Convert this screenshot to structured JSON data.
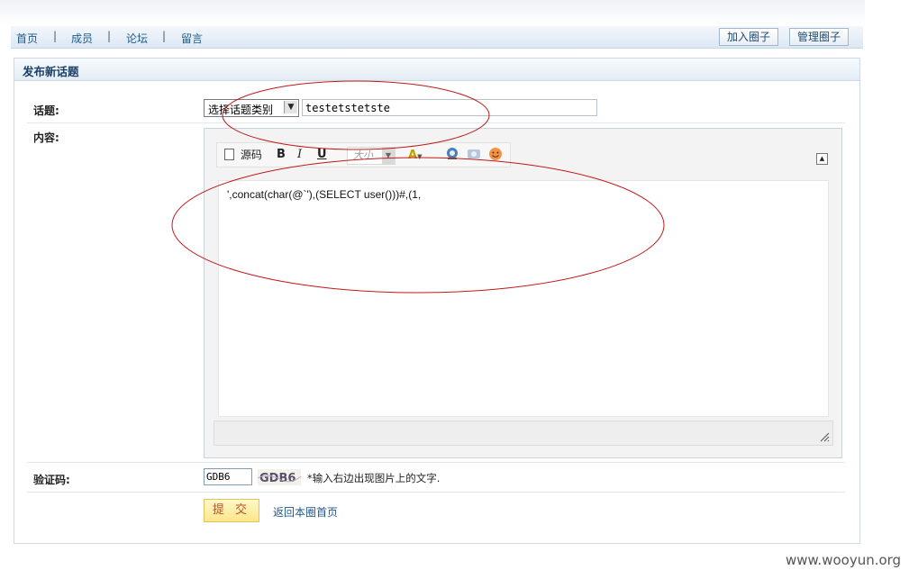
{
  "nav": {
    "links": [
      "首页",
      "成员",
      "论坛",
      "留言"
    ],
    "separator": "|",
    "buttons": {
      "join": "加入圈子",
      "manage": "管理圈子"
    }
  },
  "panel": {
    "title": "发布新话题"
  },
  "form": {
    "topic_label": "话题:",
    "category_select": "选择话题类别",
    "topic_value": "testetstetste",
    "content_label": "内容:",
    "toolbar": {
      "source": "源码",
      "bold": "B",
      "italic": "I",
      "underline": "U",
      "font_size": "大小",
      "font_color": "A"
    },
    "content_text": "',concat(char(@`'),(SELECT user()))#,(1,",
    "captcha_label": "验证码:",
    "captcha_value": "GDB6",
    "captcha_image_text": "GDB6",
    "captcha_hint": "*输入右边出现图片上的文字.",
    "submit": "提 交",
    "back_link": "返回本圈首页"
  },
  "watermark": "www.wooyun.org",
  "colors": {
    "annotation": "#c01818",
    "link": "#1f5a8a",
    "title": "#1b3f66"
  }
}
